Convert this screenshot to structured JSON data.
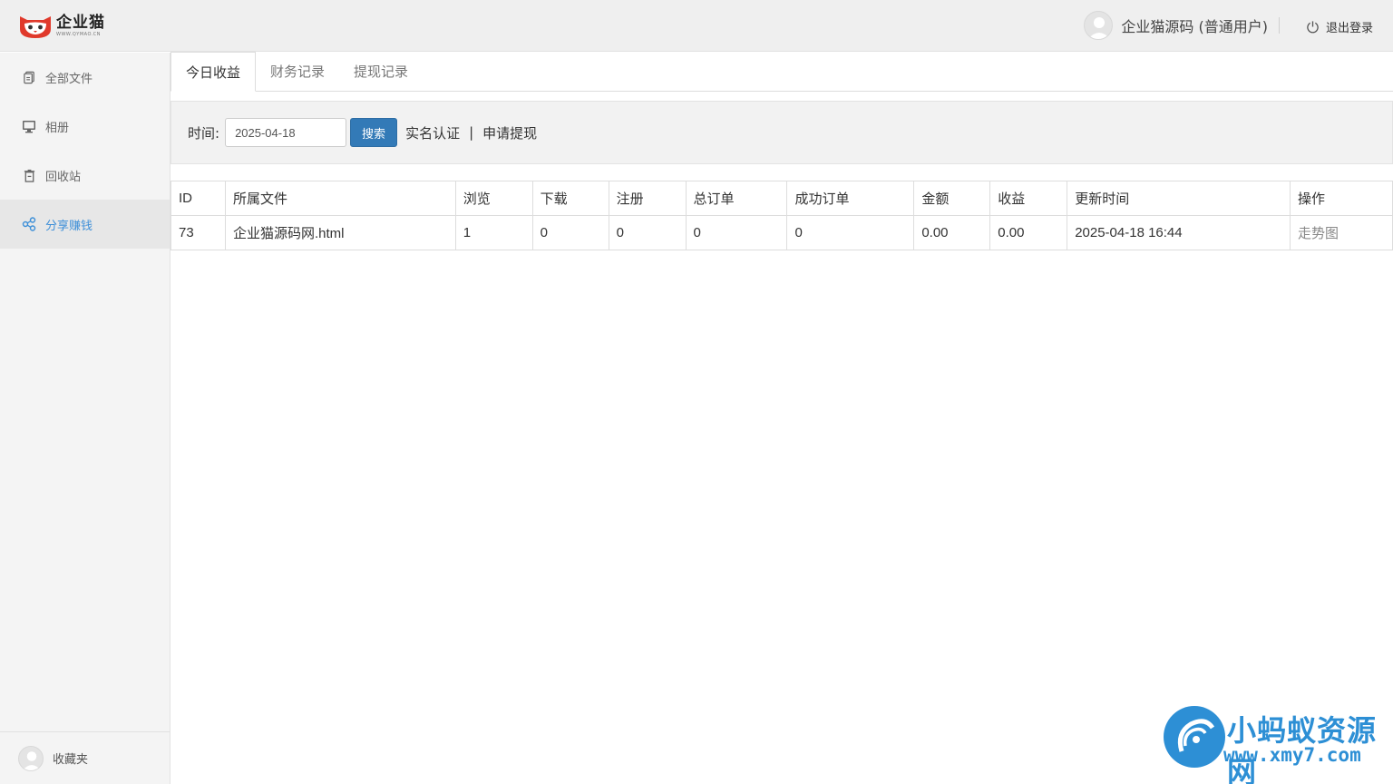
{
  "header": {
    "logo_name": "企业猫",
    "logo_url": "WWW.QYMAO.CN",
    "user_name": "企业猫源码 (普通用户)",
    "logout_label": "退出登录"
  },
  "sidebar": {
    "items": [
      {
        "label": "全部文件",
        "icon": "files-icon"
      },
      {
        "label": "相册",
        "icon": "monitor-icon"
      },
      {
        "label": "回收站",
        "icon": "trash-icon"
      },
      {
        "label": "分享赚钱",
        "icon": "share-icon",
        "active": true
      }
    ],
    "bottom_label": "收藏夹"
  },
  "tabs": [
    "今日收益",
    "财务记录",
    "提现记录"
  ],
  "filter": {
    "label": "时间:",
    "date_value": "2025-04-18",
    "search_label": "搜索",
    "link_verify": "实名认证",
    "separator": "|",
    "link_withdraw": "申请提现"
  },
  "table": {
    "headers": [
      "ID",
      "所属文件",
      "浏览",
      "下载",
      "注册",
      "总订单",
      "成功订单",
      "金额",
      "收益",
      "更新时间",
      "操作"
    ],
    "rows": [
      [
        "73",
        "企业猫源码网.html",
        "1",
        "0",
        "0",
        "0",
        "0",
        "0.00",
        "0.00",
        "2025-04-18 16:44",
        "走势图"
      ]
    ]
  },
  "watermark": {
    "title": "小蚂蚁资源网",
    "url": "www.xmy7.com"
  },
  "colors": {
    "accent": "#337ab7",
    "active_text": "#3d8fd8",
    "watermark": "#2d8fd5",
    "logo_red": "#e0392b"
  }
}
